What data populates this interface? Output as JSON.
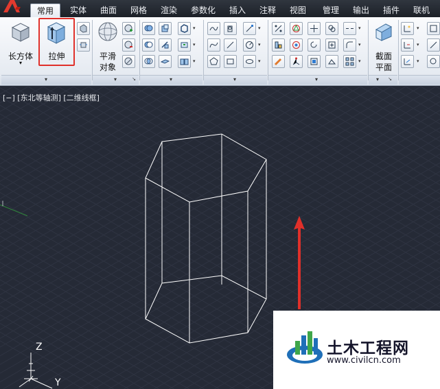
{
  "tabs": [
    {
      "label": "常用",
      "active": true
    },
    {
      "label": "实体"
    },
    {
      "label": "曲面"
    },
    {
      "label": "网格"
    },
    {
      "label": "渲染"
    },
    {
      "label": "参数化"
    },
    {
      "label": "插入"
    },
    {
      "label": "注释"
    },
    {
      "label": "视图"
    },
    {
      "label": "管理"
    },
    {
      "label": "输出"
    },
    {
      "label": "插件"
    },
    {
      "label": "联机"
    }
  ],
  "ribbon": {
    "box_label": "长方体",
    "extrude_label": "拉伸",
    "smooth_label_line1": "平滑",
    "smooth_label_line2": "对象",
    "section_label_line1": "截面",
    "section_label_line2": "平面"
  },
  "viewport": {
    "label": "[−] [东北等轴测] [二维线框]",
    "ucs_z": "Z",
    "ucs_y": "Y"
  },
  "watermark": {
    "title": "土木工程网",
    "url": "www.civilcn.com"
  },
  "colors": {
    "viewport_bg": "#252a36",
    "highlight": "#e0302a",
    "arrow": "#e0302a",
    "wireframe": "#ffffff"
  },
  "icons": [
    "autocad-logo-icon",
    "box-icon",
    "extrude-icon",
    "smooth-object-icon",
    "section-plane-icon",
    "arrow-up-icon",
    "civilcn-logo-icon"
  ]
}
